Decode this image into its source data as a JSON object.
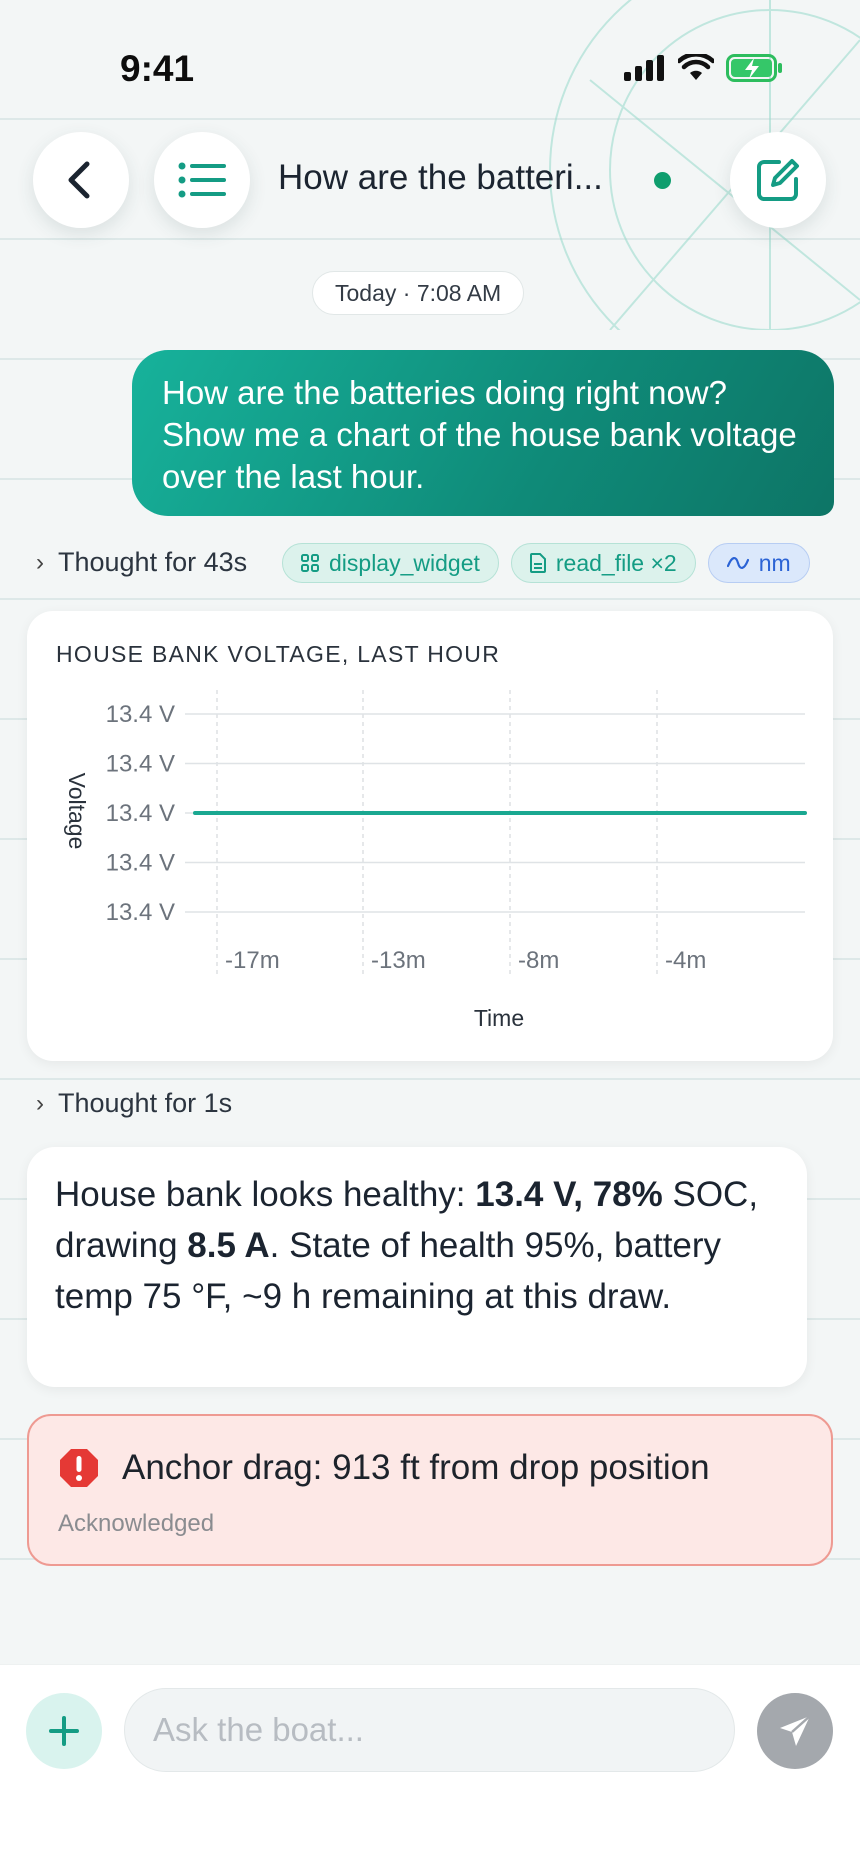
{
  "status_bar": {
    "time": "9:41"
  },
  "header": {
    "title": "How are the batteri...",
    "online_color": "#0f9e6e",
    "accent": "#149c84"
  },
  "conversation": {
    "date_label": "Today · 7:08 AM",
    "user_message": "How are the batteries doing right now? Show me a chart of the house bank voltage over the last hour.",
    "thought_1": {
      "label": "Thought for 43s",
      "tools": [
        {
          "label": "display_widget",
          "icon": "grid-icon"
        },
        {
          "label": "read_file ×2",
          "icon": "file-icon"
        },
        {
          "label": "nm",
          "icon": "wave-icon"
        }
      ]
    },
    "thought_2": {
      "label": "Thought for 1s"
    },
    "assistant_message": {
      "part1": "House bank looks healthy: ",
      "voltage": "13.4 V",
      "sep": ", ",
      "soc": "78%",
      "part2": " SOC, drawing ",
      "current": "8.5 A",
      "part3": ". State of health 95%, battery temp 75 °F, ~9 h remaining at this draw."
    },
    "alert": {
      "title": "Anchor drag: 913 ft from drop position",
      "status": "Acknowledged",
      "color": "#e53935"
    }
  },
  "composer": {
    "placeholder": "Ask the boat...",
    "value": ""
  },
  "chart_data": {
    "type": "line",
    "title": "HOUSE BANK VOLTAGE, LAST HOUR",
    "xlabel": "Time",
    "ylabel": "Voltage",
    "x_ticks": [
      "-17m",
      "-13m",
      "-8m",
      "-4m"
    ],
    "y_ticks": [
      "13.4 V",
      "13.4 V",
      "13.4 V",
      "13.4 V",
      "13.4 V"
    ],
    "series": [
      {
        "values": [
          13.4,
          13.4
        ],
        "color": "#1aa891"
      }
    ],
    "grid": true
  }
}
